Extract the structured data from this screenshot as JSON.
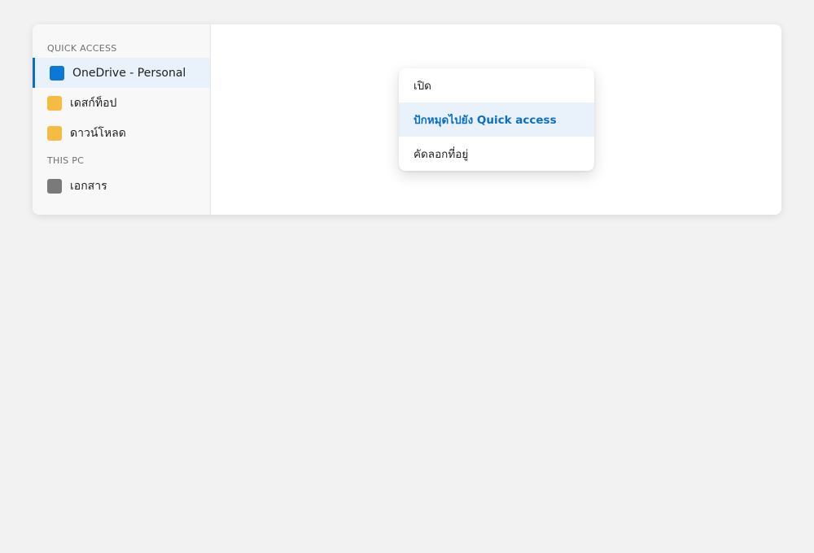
{
  "sidebar": {
    "quick_access_heading": "QUICK ACCESS",
    "quick_access_items": [
      {
        "label": "OneDrive - Personal",
        "icon": "onedrive-icon",
        "icon_color": "#0a78d4",
        "selected": true
      },
      {
        "label": "เดสก์ท็อป",
        "icon": "folder-icon",
        "icon_color": "#f4bc42"
      },
      {
        "label": "ดาวน์โหลด",
        "icon": "folder-icon",
        "icon_color": "#f4bc42"
      }
    ],
    "this_pc_heading": "THIS PC",
    "this_pc_items": [
      {
        "label": "เอกสาร",
        "icon": "documents-icon",
        "icon_color": "#7a7a7a"
      }
    ]
  },
  "context_menu": {
    "items": [
      {
        "label": "เปิด"
      },
      {
        "label": "ปักหมุดไปยัง Quick access",
        "highlighted": true
      },
      {
        "label": "คัดลอกที่อยู่"
      }
    ]
  },
  "colors": {
    "accent": "#0a6fc2",
    "selection_background": "#e9f1fa"
  }
}
